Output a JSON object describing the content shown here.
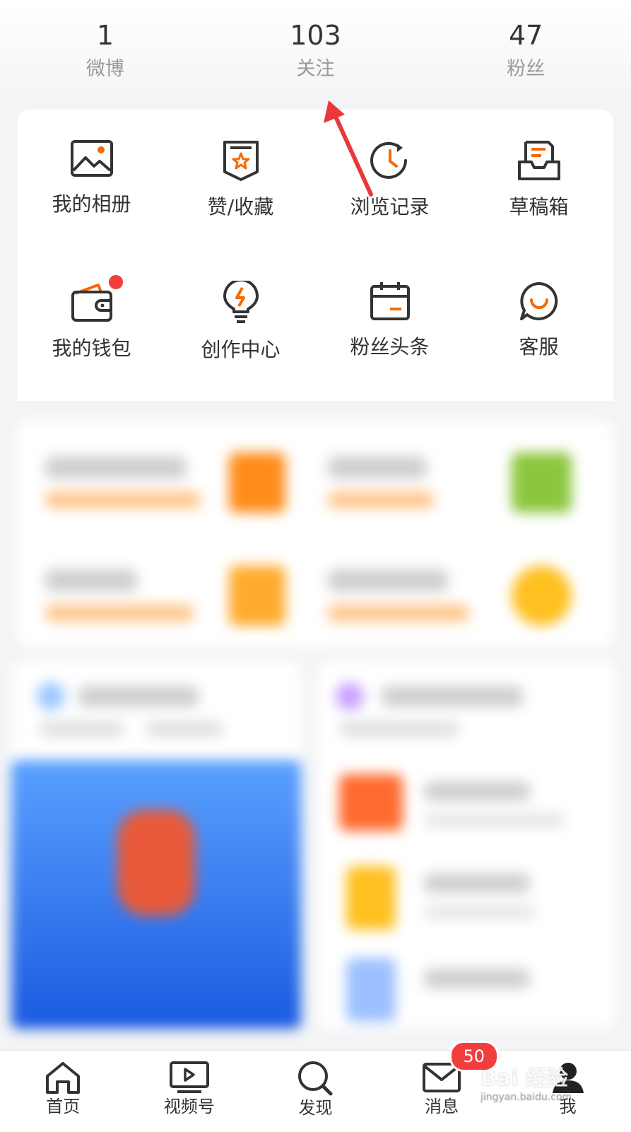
{
  "stats": [
    {
      "value": "1",
      "label": "微博"
    },
    {
      "value": "103",
      "label": "关注"
    },
    {
      "value": "47",
      "label": "粉丝"
    }
  ],
  "tools": [
    {
      "label": "我的相册",
      "icon": "album-icon"
    },
    {
      "label": "赞/收藏",
      "icon": "favorites-icon"
    },
    {
      "label": "浏览记录",
      "icon": "history-icon"
    },
    {
      "label": "草稿箱",
      "icon": "drafts-icon"
    },
    {
      "label": "我的钱包",
      "icon": "wallet-icon"
    },
    {
      "label": "创作中心",
      "icon": "creator-icon"
    },
    {
      "label": "粉丝头条",
      "icon": "calendar-icon"
    },
    {
      "label": "客服",
      "icon": "service-icon"
    }
  ],
  "tabbar": {
    "items": [
      {
        "label": "首页",
        "icon": "home-icon"
      },
      {
        "label": "视频号",
        "icon": "video-icon"
      },
      {
        "label": "发现",
        "icon": "search-icon"
      },
      {
        "label": "消息",
        "icon": "mail-icon",
        "badge": "50"
      },
      {
        "label": "我",
        "icon": "profile-icon"
      }
    ]
  },
  "colors": {
    "accent": "#f56a00",
    "badge": "#f23d3d",
    "arrow": "#e8383b"
  },
  "watermark": {
    "text": "Bai 经验",
    "sub": "jingyan.baidu.com"
  }
}
